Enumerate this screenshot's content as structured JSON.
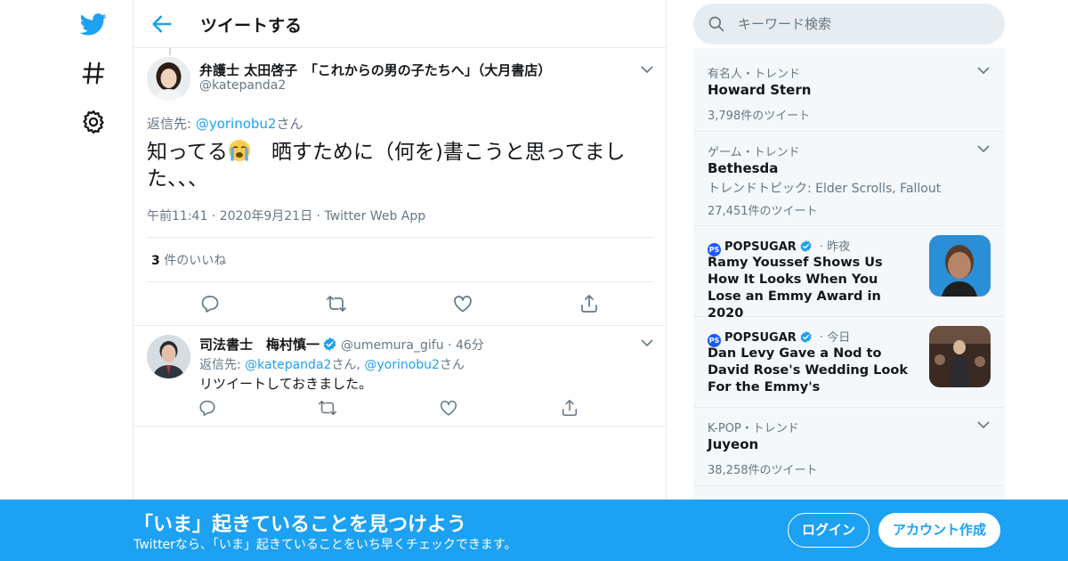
{
  "colors": {
    "accent": "#1da1f2",
    "muted": "#657786",
    "border": "#e6ecf0"
  },
  "nav": {
    "icons": [
      "twitter-bird-icon",
      "hashtag-icon",
      "gear-icon"
    ]
  },
  "header": {
    "title": "ツイートする"
  },
  "main_tweet": {
    "author_name": "弁護士 太田啓子　「これからの男の子たちへ」（大月書店）",
    "handle": "@katepanda2",
    "reply_prefix": "返信先: ",
    "reply_user": "@yorinobu2",
    "reply_suffix": "さん",
    "text_before_emoji": "知ってる",
    "emoji": "loudly-crying-face-icon",
    "text_after_emoji": "　晒すために（何を)書こうと思ってました、、、",
    "time": "午前11:41",
    "date": "2020年9月21日",
    "source": "Twitter Web App",
    "like_count": "3",
    "like_label": " 件のいいね"
  },
  "reply_tweet": {
    "author_name": "司法書士　梅村慎一",
    "handle": "@umemura_gifu",
    "age": "46分",
    "reply_prefix": "返信先: ",
    "reply_user1": "@katepanda2",
    "reply_mid": "さん, ",
    "reply_user2": "@yorinobu2",
    "reply_suffix": "さん",
    "text": "リツイートしておきました。"
  },
  "search": {
    "placeholder": "キーワード検索"
  },
  "trends": [
    {
      "context": "有名人・トレンド",
      "title": "Howard Stern",
      "count": "3,798件のツイート"
    },
    {
      "context": "ゲーム・トレンド",
      "title": "Bethesda",
      "topics": "トレンドトピック: Elder Scrolls, Fallout",
      "count": "27,451件のツイート"
    },
    {
      "source": "POPSUGAR",
      "time": "昨夜",
      "headline": "Ramy Youssef Shows Us How It Looks When You Lose an Emmy Award in 2020"
    },
    {
      "source": "POPSUGAR",
      "time": "今日",
      "headline": "Dan Levy Gave a Nod to David Rose's Wedding Look For the Emmy's"
    },
    {
      "context": "K-POP・トレンド",
      "title": "Juyeon",
      "count": "38,258件のツイート"
    }
  ],
  "banner": {
    "title": "「いま」起きていることを見つけよう",
    "subtitle": "Twitterなら、「いま」起きていることをいち早くチェックできます。",
    "login_label": "ログイン",
    "signup_label": "アカウント作成"
  }
}
